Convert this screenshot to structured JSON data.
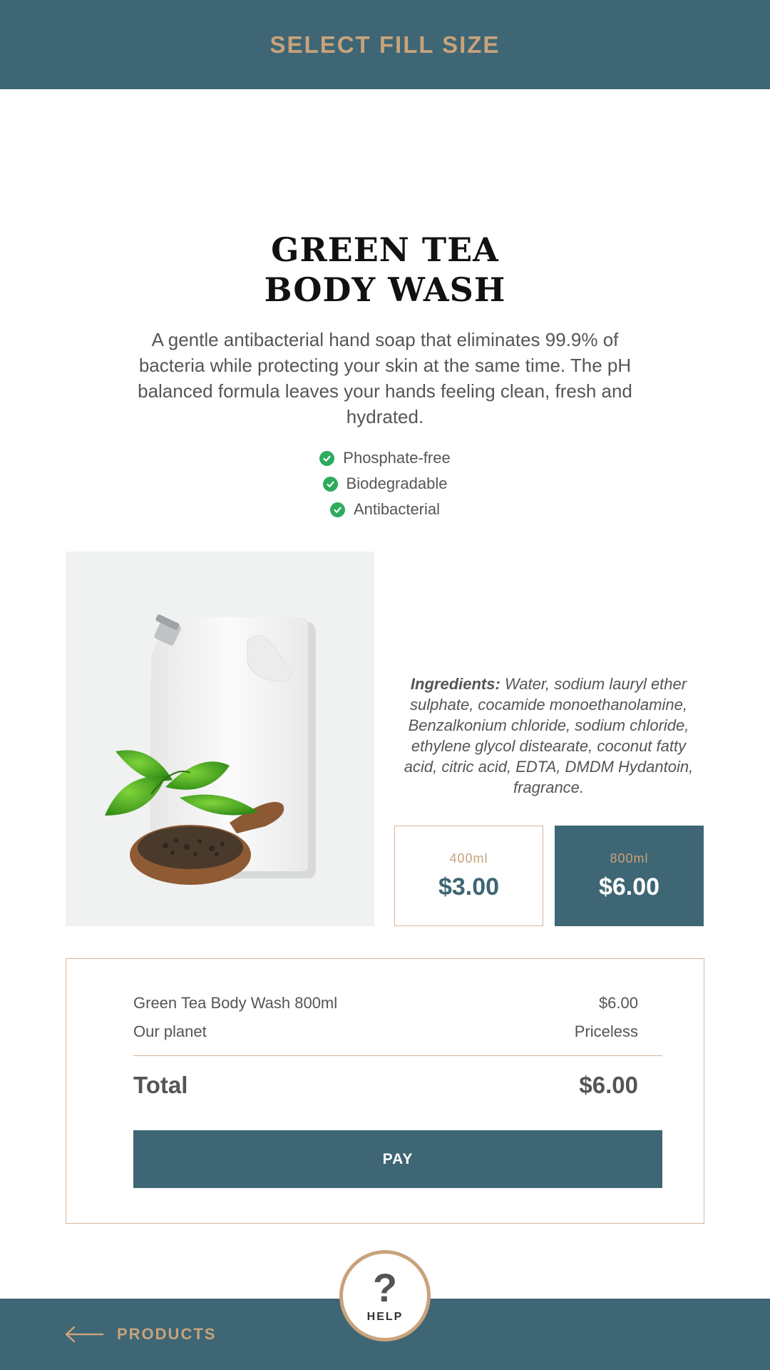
{
  "header": {
    "title": "SELECT FILL SIZE"
  },
  "product": {
    "title_line1": "GREEN TEA",
    "title_line2": "BODY WASH",
    "description": "A gentle antibacterial hand soap that eliminates 99.9% of bacteria while protecting your skin at the same time. The pH balanced formula leaves your hands feeling clean, fresh and hydrated.",
    "features": [
      "Phosphate-free",
      "Biodegradable",
      "Antibacterial"
    ],
    "ingredients_label": "Ingredients:",
    "ingredients_text": "Water, sodium lauryl ether sulphate, cocamide monoethanolamine, Benzalkonium chloride, sodium chloride, ethylene glycol distearate, coconut fatty acid, citric acid, EDTA, DMDM Hydantoin, fragrance."
  },
  "sizes": [
    {
      "label": "400ml",
      "price": "$3.00",
      "selected": false
    },
    {
      "label": "800ml",
      "price": "$6.00",
      "selected": true
    }
  ],
  "order": {
    "lines": [
      {
        "name": "Green Tea Body Wash 800ml",
        "value": "$6.00"
      },
      {
        "name": "Our planet",
        "value": "Priceless"
      }
    ],
    "total_label": "Total",
    "total_value": "$6.00",
    "pay_label": "PAY"
  },
  "footer": {
    "back_label": "PRODUCTS",
    "help_symbol": "?",
    "help_label": "HELP"
  },
  "colors": {
    "primary": "#3e6674",
    "accent": "#c9a27c",
    "check": "#2fab5f"
  },
  "icons": {
    "feature": "check-circle-icon",
    "back": "arrow-left-icon"
  }
}
